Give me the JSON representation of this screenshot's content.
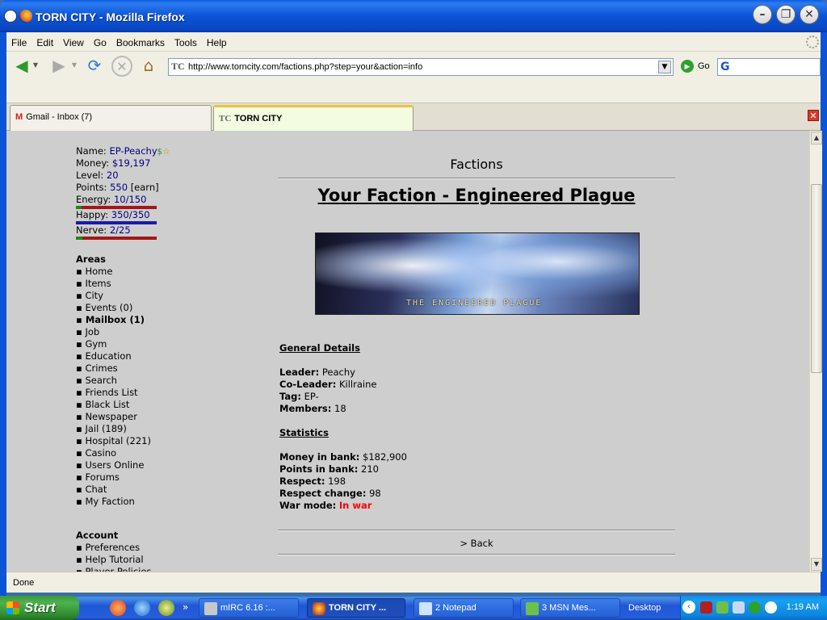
{
  "window": {
    "title": "TORN CITY - Mozilla Firefox"
  },
  "menu": [
    "File",
    "Edit",
    "View",
    "Go",
    "Bookmarks",
    "Tools",
    "Help"
  ],
  "nav": {
    "url": "http://www.torncity.com/factions.php?step=your&action=info",
    "go_label": "Go",
    "site_icon_text": "TC"
  },
  "tabs": [
    {
      "label": "Gmail - Inbox (7)",
      "icon": "M",
      "active": false
    },
    {
      "label": "TORN CITY",
      "icon": "TC",
      "active": true
    }
  ],
  "player": {
    "name_label": "Name:",
    "name": "EP-Peachy",
    "money_label": "Money:",
    "money": "$19,197",
    "level_label": "Level:",
    "level": "20",
    "points_label": "Points:",
    "points": "550",
    "earn": "[earn]",
    "energy_label": "Energy:",
    "energy": "10/150",
    "energy_fraction": 0.067,
    "happy_label": "Happy:",
    "happy": "350/350",
    "happy_fraction": 1.0,
    "nerve_label": "Nerve:",
    "nerve": "2/25",
    "nerve_fraction": 0.08
  },
  "areas": {
    "title": "Areas",
    "items": [
      "Home",
      "Items",
      "City",
      "Events (0)",
      "Mailbox (1)",
      "Job",
      "Gym",
      "Education",
      "Crimes",
      "Search",
      "Friends List",
      "Black List",
      "Newspaper",
      "Jail (189)",
      "Hospital (221)",
      "Casino",
      "Users Online",
      "Forums",
      "Chat",
      "My Faction"
    ]
  },
  "account": {
    "title": "Account",
    "items": [
      "Preferences",
      "Help Tutorial",
      "Player Policies"
    ]
  },
  "faction": {
    "page_title": "Factions",
    "heading": "Your Faction - Engineered Plague",
    "banner_text": "THE ENGINEERED PLAGUE",
    "general_title": "General Details",
    "leader_label": "Leader:",
    "leader": "Peachy",
    "coleader_label": "Co-Leader:",
    "coleader": "Killraine",
    "tag_label": "Tag:",
    "tag": "EP-",
    "members_label": "Members:",
    "members": "18",
    "stats_title": "Statistics",
    "bank_money_label": "Money in bank:",
    "bank_money": "$182,900",
    "bank_points_label": "Points in bank:",
    "bank_points": "210",
    "respect_label": "Respect:",
    "respect": "198",
    "respect_change_label": "Respect change:",
    "respect_change": "98",
    "war_label": "War mode:",
    "war": "In war",
    "back": "> Back"
  },
  "status": "Done",
  "taskbar": {
    "start": "Start",
    "buttons": [
      {
        "label": "mIRC 6.16 :...",
        "active": false
      },
      {
        "label": "TORN CITY ...",
        "active": true
      },
      {
        "label": "2 Notepad",
        "active": false
      },
      {
        "label": "3 MSN Mes...",
        "active": false
      }
    ],
    "desktop": "Desktop",
    "clock": "1:19 AM"
  },
  "colors": {
    "energy_bar": "#a01818",
    "happy_bar": "#1a1aa8",
    "nerve_bar": "#a01818",
    "war": "#ff0000",
    "link": "#000080"
  }
}
